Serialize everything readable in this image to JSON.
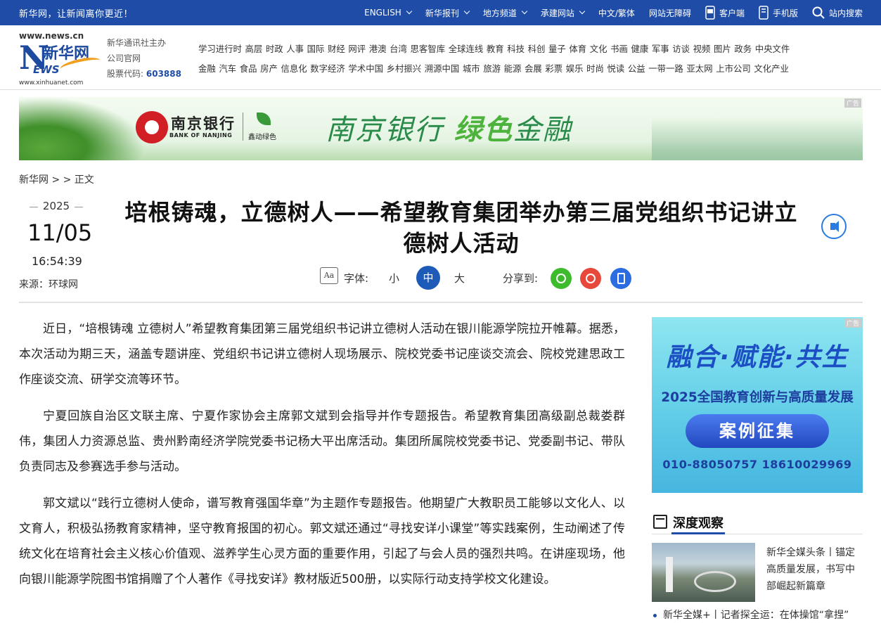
{
  "topbar": {
    "slogan": "新华网，让新闻离你更近！",
    "nav": [
      {
        "label": "ENGLISH",
        "dropdown": true
      },
      {
        "label": "新华报刊",
        "dropdown": true
      },
      {
        "label": "地方频道",
        "dropdown": true
      },
      {
        "label": "承建网站",
        "dropdown": true
      },
      {
        "label": "中文/繁体",
        "dropdown": false
      },
      {
        "label": "网站无障碍",
        "dropdown": false
      },
      {
        "label": "客户端",
        "icon": "app-icon"
      },
      {
        "label": "手机版",
        "icon": "phone-icon"
      },
      {
        "label": "站内搜索",
        "icon": "search-icon"
      }
    ]
  },
  "header": {
    "logo": {
      "site": "www.news.cn",
      "brand": "新华网",
      "url": "www.xinhuanet.com"
    },
    "org_line1": "新华通讯社主办",
    "org_line2": "公司官网",
    "stock_label": "股票代码:",
    "stock_code": "603888",
    "channels_row1": [
      "学习进行时",
      "高层",
      "时政",
      "人事",
      "国际",
      "财经",
      "网评",
      "港澳",
      "台湾",
      "思客智库",
      "全球连线",
      "教育",
      "科技",
      "科创",
      "量子",
      "体育",
      "文化",
      "书画",
      "健康",
      "军事",
      "访谈",
      "视频",
      "图片",
      "政务",
      "中央文件"
    ],
    "channels_row2": [
      "金融",
      "汽车",
      "食品",
      "房产",
      "信息化",
      "数字经济",
      "学术中国",
      "乡村振兴",
      "溯源中国",
      "城市",
      "旅游",
      "能源",
      "会展",
      "彩票",
      "娱乐",
      "时尚",
      "悦读",
      "公益",
      "一带一路",
      "亚太网",
      "上市公司",
      "文化产业"
    ]
  },
  "banner_ad": {
    "tag": "广告",
    "bank_name": "南京银行",
    "bank_en": "BANK OF NANJING",
    "bank_sub": "鑫动绿色",
    "slogan_a": "南京银行",
    "slogan_b": "绿色",
    "slogan_c": "金融"
  },
  "breadcrumb": "新华网 > > 正文",
  "meta": {
    "year": "2025",
    "month_day": "11/05",
    "time": "16:54:39",
    "source_label": "来源：",
    "source": "环球网"
  },
  "title": "培根铸魂，立德树人——希望教育集团举办第三届党组织书记讲立德树人活动",
  "tools": {
    "font_label": "字体:",
    "sizes": [
      "小",
      "中",
      "大"
    ],
    "active_size": "中",
    "share_label": "分享到:"
  },
  "article": {
    "paragraphs": [
      "近日，“培根铸魂 立德树人”希望教育集团第三届党组织书记讲立德树人活动在银川能源学院拉开帷幕。据悉，本次活动为期三天，涵盖专题讲座、党组织书记讲立德树人现场展示、院校党委书记座谈交流会、院校党建思政工作座谈交流、研学交流等环节。",
      "宁夏回族自治区文联主席、宁夏作家协会主席郭文斌到会指导并作专题报告。希望教育集团高级副总裁娄群伟，集团人力资源总监、贵州黔南经济学院党委书记杨大平出席活动。集团所属院校党委书记、党委副书记、带队负责同志及参赛选手参与活动。",
      "郭文斌以“践行立德树人使命，谱写教育强国华章”为主题作专题报告。他期望广大教职员工能够以文化人、以文育人，积极弘扬教育家精神，坚守教育报国的初心。郭文斌还通过“寻找安详小课堂”等实践案例，生动阐述了传统文化在培育社会主义核心价值观、滋养学生心灵方面的重要作用，引起了与会人员的强烈共鸣。在讲座现场，他向银川能源学院图书馆捐赠了个人著作《寻找安详》教材版近500册，以实际行动支持学校文化建设。"
    ]
  },
  "side_ad": {
    "tag": "广告",
    "headline": "融合·赋能·共生",
    "subline": "2025全国教育创新与高质量发展",
    "button": "案例征集",
    "phones": "010-88050757 18610029969"
  },
  "deep": {
    "heading": "深度观察",
    "item1": "新华全媒头条丨锚定高质量发展，书写中部崛起新篇章",
    "item2": "新华全媒+丨记者探全运：在体操馆“拿捏”"
  },
  "colors": {
    "brand_blue": "#1e4ca6",
    "wechat": "#3dbb2c",
    "weibo": "#e8473b",
    "mobile": "#2b6de0"
  }
}
